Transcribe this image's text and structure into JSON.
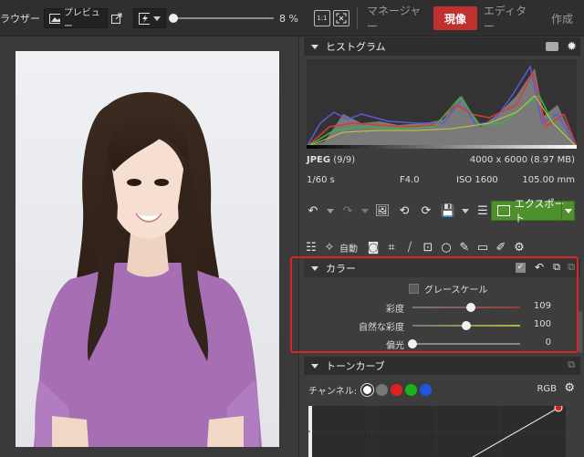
{
  "topbar": {
    "browser_label": "ラウザー",
    "preview_label": "プレビュー",
    "zoom_percent": "8 %",
    "zoom_1to1": "1:1",
    "tabs": [
      {
        "label": "マネージャー",
        "active": false
      },
      {
        "label": "現像",
        "active": true
      },
      {
        "label": "エディター",
        "active": false
      },
      {
        "label": "作成",
        "active": false
      }
    ]
  },
  "histogram": {
    "title": "ヒストグラム",
    "format": "JPEG",
    "index": "(9/9)",
    "dimensions": "4000 x 6000 (8.97 MB)",
    "shutter": "1/60 s",
    "aperture": "F4.0",
    "iso": "ISO 1600",
    "focal": "105.00 mm"
  },
  "toolbar": {
    "export_label": "エクスポート",
    "auto_label": "自動"
  },
  "color_panel": {
    "title": "カラー",
    "grayscale_label": "グレースケール",
    "sliders": [
      {
        "label": "彩度",
        "value": "109",
        "level": 0.545
      },
      {
        "label": "自然な彩度",
        "value": "100",
        "level": 0.5
      },
      {
        "label": "偏光",
        "value": "0",
        "level": 0.0
      }
    ]
  },
  "tone_curve": {
    "title": "トーンカーブ",
    "channel_label": "チャンネル:",
    "channel_value": "RGB",
    "channels": [
      "white",
      "gray",
      "red",
      "green",
      "blue"
    ]
  },
  "colors": {
    "accent_red": "#c0302e",
    "export_green": "#4e8f2e",
    "highlight_frame": "#d8232a"
  }
}
